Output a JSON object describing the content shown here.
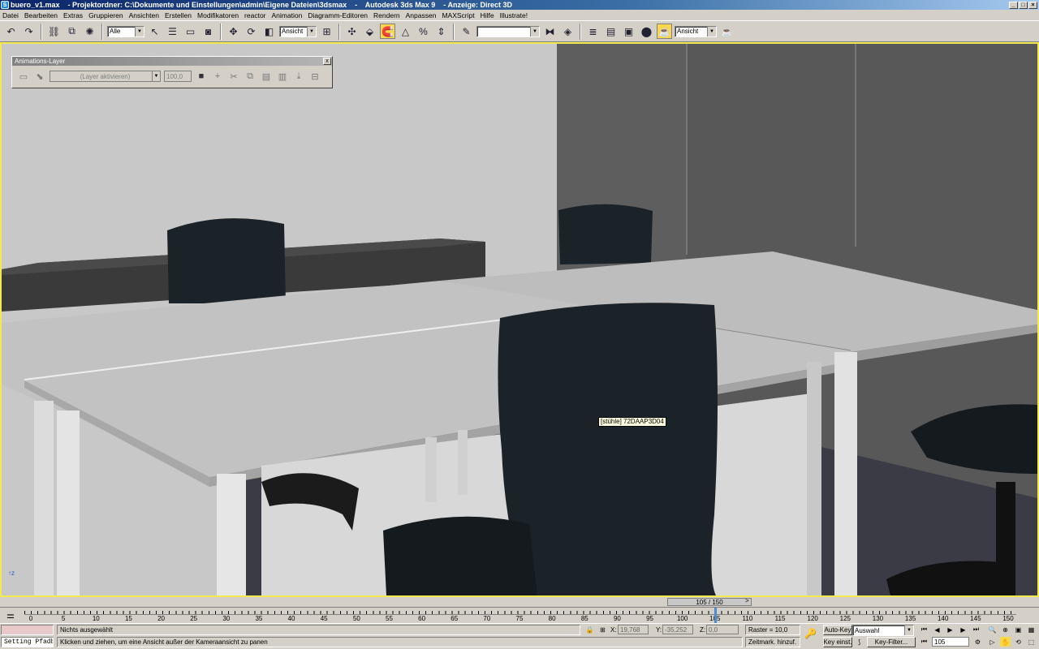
{
  "window": {
    "title": "buero_v1.max    - Projektordner: C:\\Dokumente und Einstellungen\\admin\\Eigene Dateien\\3dsmax    -    Autodesk 3ds Max 9    - Anzeige: Direct 3D",
    "app_icon": "3ds-max-icon",
    "btn_min": "_",
    "btn_max": "□",
    "btn_close": "×"
  },
  "menu": [
    "Datei",
    "Bearbeiten",
    "Extras",
    "Gruppieren",
    "Ansichten",
    "Erstellen",
    "Modifikatoren",
    "reactor",
    "Animation",
    "Diagramm-Editoren",
    "Rendern",
    "Anpassen",
    "MAXScript",
    "Hilfe",
    "Illustrate!"
  ],
  "toolbar": {
    "selection_filter": "Alle",
    "coord_system": "Ansicht",
    "named_selection": "",
    "view_dropdown": "Ansicht"
  },
  "anim_layer": {
    "title": "Animations-Layer",
    "layer_combo": "(Layer aktivieren)",
    "weight": "100,0",
    "close": "x"
  },
  "viewport": {
    "tooltip": "[stühle] 72DAAP3D04",
    "colors": {
      "border": "#f2e94e",
      "wall_left": "#c8c8c8",
      "wall_right": "#5a5a5a",
      "desk_top": "#bdbdbd",
      "chair": "#1b2328",
      "carpet": "#3a3a44"
    }
  },
  "timeslider": {
    "frame": "105 / 150",
    "prev": "<",
    "next": ">"
  },
  "trackbar": {
    "ticks": [
      "0",
      "5",
      "10",
      "15",
      "20",
      "25",
      "30",
      "35",
      "40",
      "45",
      "50",
      "55",
      "60",
      "65",
      "70",
      "75",
      "80",
      "85",
      "90",
      "95",
      "100",
      "105",
      "110",
      "115",
      "120",
      "125",
      "130",
      "135",
      "140",
      "145",
      "150"
    ],
    "current_frame": 105,
    "max_frame": 150
  },
  "status": {
    "maxscript_listener": "",
    "script_label": "Setting Pfadb",
    "selection": "Nichts ausgewählt",
    "prompt": "Klicken und ziehen, um eine Ansicht außer der Kameraansicht zu panen",
    "x_label": "X:",
    "x_value": "19,768",
    "y_label": "Y:",
    "y_value": "-35,252",
    "z_label": "Z:",
    "z_value": "0,0",
    "grid": "Raster = 10,0",
    "add_time_tag": "Zeitmark. hinzuf.",
    "auto_key": "Auto-Key",
    "selection_set": "Auswahl",
    "set_key": "Key einst.",
    "key_filters": "Key-Filter...",
    "current_frame": "105"
  }
}
